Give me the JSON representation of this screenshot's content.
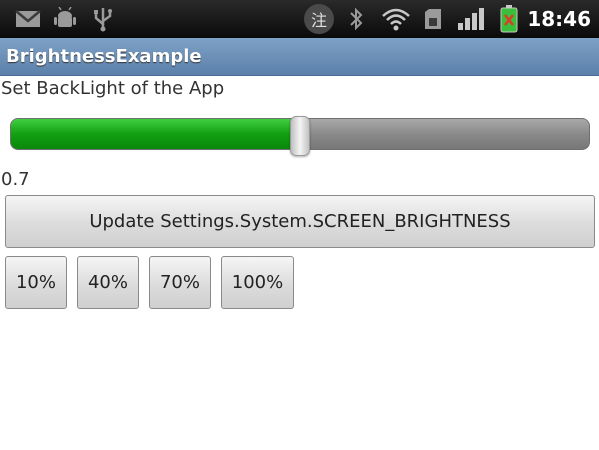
{
  "status_bar": {
    "time": "18:46",
    "icons": [
      "gmail-icon",
      "android-debug-icon",
      "usb-icon",
      "input-method-icon",
      "bluetooth-icon",
      "wifi-icon",
      "sd-card-icon",
      "signal-icon",
      "battery-charging-icon"
    ],
    "ime_glyph": "注"
  },
  "app": {
    "title": "BrightnessExample"
  },
  "main": {
    "label": "Set BackLight of the App",
    "brightness": {
      "value": 0.5,
      "display": "0.7"
    },
    "update_button": "Update Settings.System.SCREEN_BRIGHTNESS",
    "preset_buttons": [
      "10%",
      "40%",
      "70%",
      "100%"
    ]
  },
  "colors": {
    "progress_green": "#12a012",
    "title_bar_blue": "#6b8fb8",
    "status_bar": "#111111"
  }
}
